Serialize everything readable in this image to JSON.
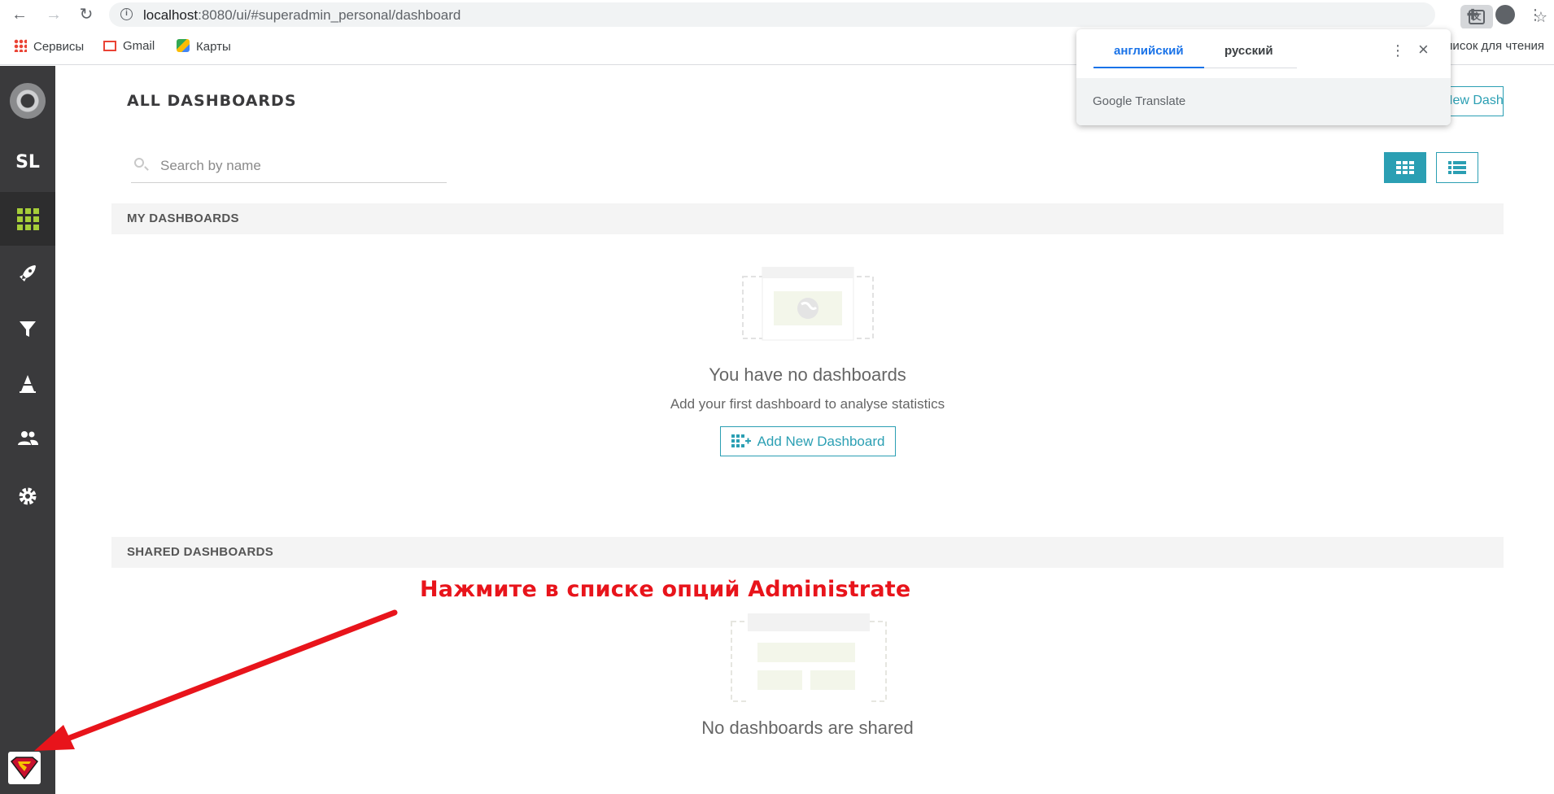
{
  "browser": {
    "url_host": "localhost",
    "url_rest": ":8080/ui/#superadmin_personal/dashboard",
    "bookmarks": [
      "Сервисы",
      "Gmail",
      "Карты"
    ],
    "reading_list": "писок для чтения"
  },
  "translate_popup": {
    "tab_english": "английский",
    "tab_russian": "русский",
    "footer": "Google Translate"
  },
  "sidebar": {
    "initials": "SL",
    "items": [
      "logo-icon",
      "dashboards-grid-icon",
      "rocket-icon",
      "filter-icon",
      "alert-cone-icon",
      "users-icon",
      "gear-icon"
    ]
  },
  "header": {
    "title": "ALL DASHBOARDS",
    "add_button": "Add New Dashboard"
  },
  "search": {
    "placeholder": "Search by name"
  },
  "my_dashboards": {
    "heading": "MY DASHBOARDS",
    "empty_title": "You have no dashboards",
    "empty_subtitle": "Add your first dashboard to analyse statistics",
    "add_button": "Add New Dashboard"
  },
  "shared_dashboards": {
    "heading": "SHARED DASHBOARDS",
    "empty_title": "No dashboards are shared"
  },
  "annotation": "Нажмите в списке опций Administrate",
  "colors": {
    "accent": "#2b9fb3",
    "sidebar": "#3a3a3c",
    "active_icon": "#a6ce39",
    "annotation": "#e8141b"
  }
}
